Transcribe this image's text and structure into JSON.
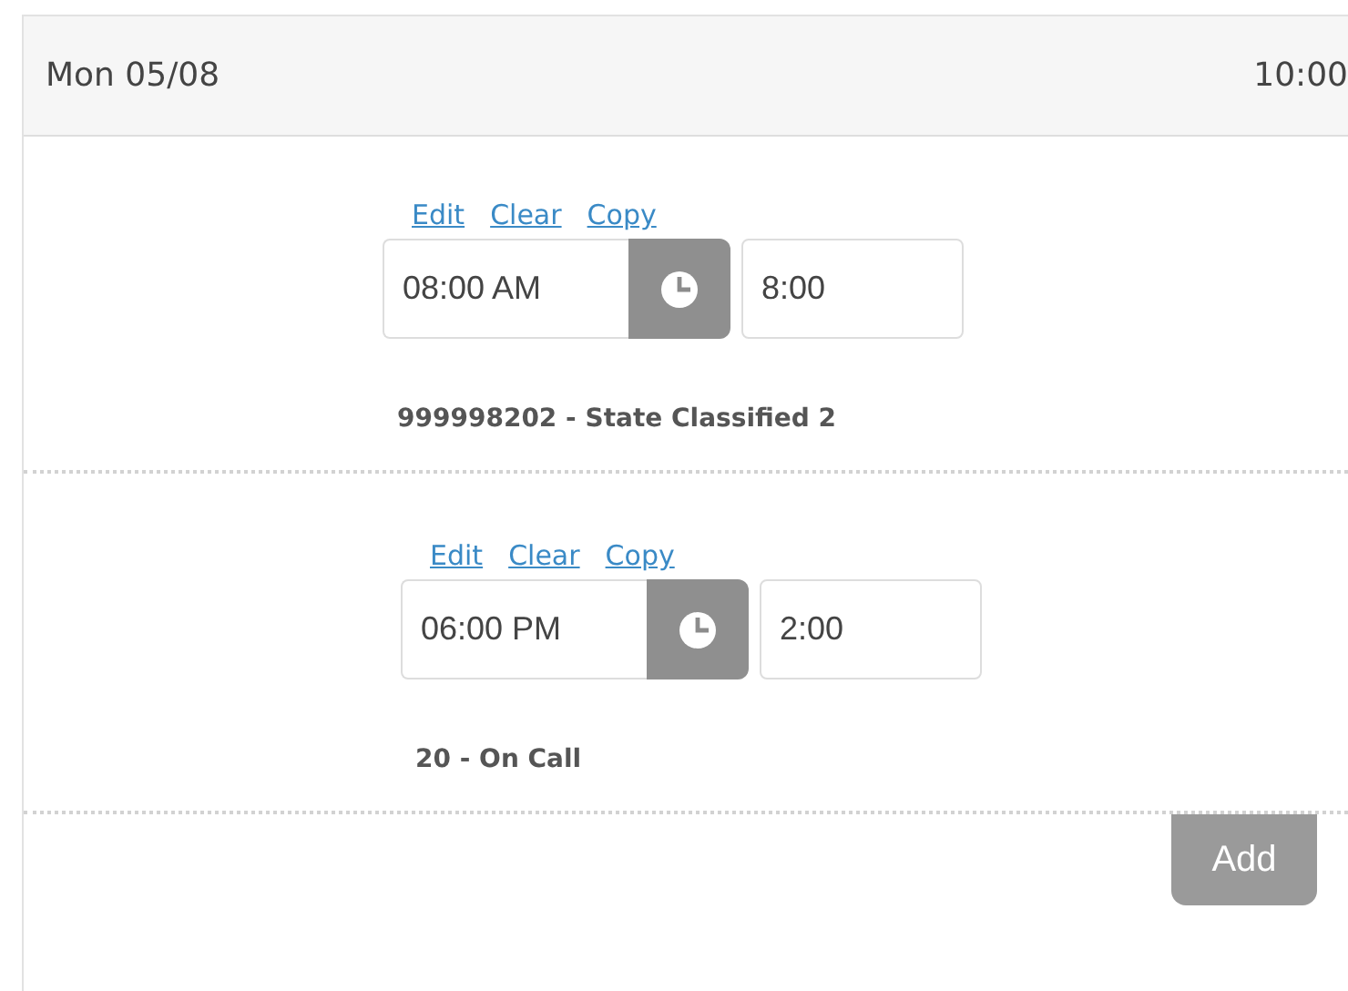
{
  "day": {
    "label": "Mon 05/08",
    "total": "10:00"
  },
  "entries": [
    {
      "links": [
        "Edit",
        "Clear",
        "Copy"
      ],
      "start": "08:00 AM",
      "duration": "8:00",
      "description": "999998202 - State Classified 2"
    },
    {
      "links": [
        "Edit",
        "Clear",
        "Copy"
      ],
      "start": "06:00 PM",
      "duration": "2:00",
      "description": "20 - On Call"
    }
  ],
  "add_button": "Add"
}
